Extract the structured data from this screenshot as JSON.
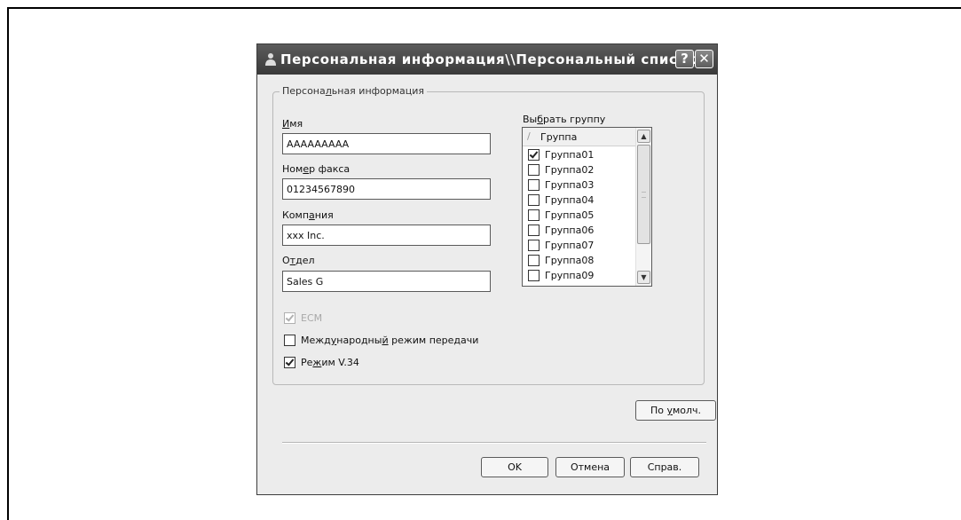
{
  "dialog": {
    "title": "Персональная информация\\\\Персональный список",
    "help_glyph": "?",
    "close_glyph": "✕"
  },
  "group": {
    "legend_pre": "Персона",
    "legend_acc": "л",
    "legend_post": "ьная информация"
  },
  "fields": {
    "name": {
      "label_acc": "И",
      "label_post": "мя",
      "value": "AAAAAAAAA"
    },
    "fax": {
      "label_pre": "Ном",
      "label_acc": "е",
      "label_post": "р факса",
      "value": "01234567890"
    },
    "company": {
      "label_pre": "Комп",
      "label_acc": "а",
      "label_post": "ния",
      "value": "xxx Inc."
    },
    "department": {
      "label_pre": "О",
      "label_acc": "т",
      "label_post": "дел",
      "value": "Sales G"
    }
  },
  "groups_list": {
    "label_pre": "Вы",
    "label_acc": "б",
    "label_post": "рать группу",
    "column_header": "Группа",
    "sort_glyph": "/",
    "items": [
      {
        "name": "Группа01",
        "checked": true
      },
      {
        "name": "Группа02",
        "checked": false
      },
      {
        "name": "Группа03",
        "checked": false
      },
      {
        "name": "Группа04",
        "checked": false
      },
      {
        "name": "Группа05",
        "checked": false
      },
      {
        "name": "Группа06",
        "checked": false
      },
      {
        "name": "Группа07",
        "checked": false
      },
      {
        "name": "Группа08",
        "checked": false
      },
      {
        "name": "Группа09",
        "checked": false
      }
    ]
  },
  "options": {
    "ecm": {
      "label": "ECM",
      "checked": true,
      "disabled": true
    },
    "intl": {
      "label_pre": "Межд",
      "label_acc": "у",
      "label_mid": "народны",
      "label_acc2": "й",
      "label_post": " режим передачи",
      "checked": false
    },
    "v34": {
      "label_pre": "Ре",
      "label_acc": "ж",
      "label_post": "им V.34",
      "checked": true
    }
  },
  "buttons": {
    "default_pre": "По ",
    "default_acc": "у",
    "default_post": "молч.",
    "ok": "OK",
    "cancel": "Отмена",
    "help": "Справ."
  }
}
